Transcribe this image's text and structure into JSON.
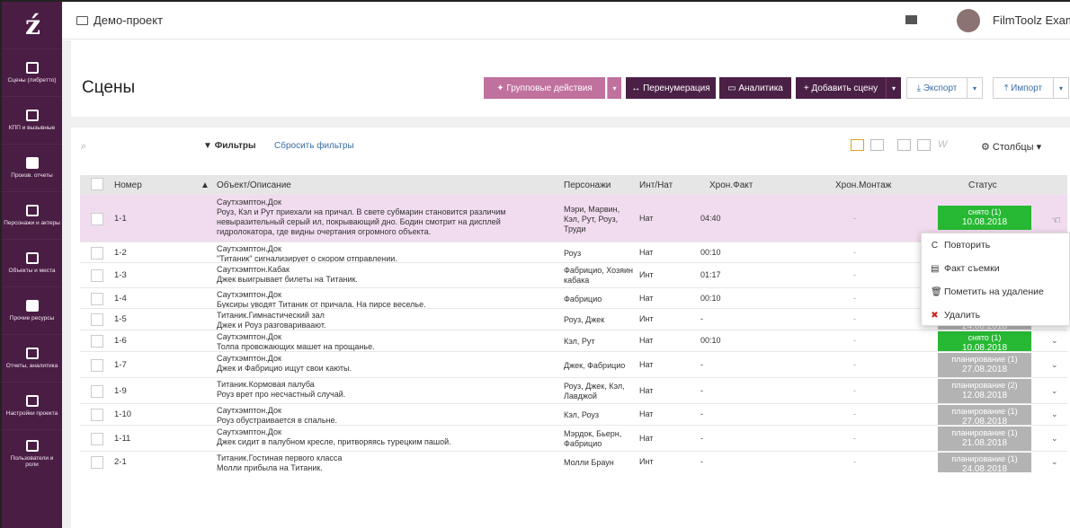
{
  "sidebar": {
    "logo": "ź",
    "items": [
      {
        "label": "Сцены (либретто)",
        "icon": "clapperboard-icon"
      },
      {
        "label": "КПП и вызывные",
        "icon": "calendar-icon"
      },
      {
        "label": "Произв. отчеты",
        "icon": "check-icon"
      },
      {
        "label": "Персонажи и актеры",
        "icon": "people-icon"
      },
      {
        "label": "Объекты и места",
        "icon": "image-icon"
      },
      {
        "label": "Прочие ресурсы",
        "icon": "box-icon"
      },
      {
        "label": "Отчеты, аналитика",
        "icon": "bar-chart-icon"
      },
      {
        "label": "Настройки проекта",
        "icon": "sliders-icon"
      },
      {
        "label": "Пользователи и роли",
        "icon": "users-icon"
      }
    ]
  },
  "topbar": {
    "project": "Демо-проект",
    "username": "FilmToolz Examp"
  },
  "header": {
    "title": "Сцены",
    "group_actions": "Групповые действия",
    "renumber": "Перенумерация",
    "analytics": "Аналитика",
    "add_scene": "+ Добавить сцену",
    "export": "Экспорт",
    "import": "Импорт"
  },
  "toolbar": {
    "search_placeholder": "",
    "filters": "Фильтры",
    "reset_filters": "Сбросить фильтры",
    "columns": "Столбцы"
  },
  "table": {
    "columns": {
      "num": "Номер",
      "obj": "Объект/Описание",
      "per": "Персонажи",
      "int": "Инт/Нат",
      "hf": "Хрон.Факт",
      "hm": "Хрон.Монтаж",
      "stat": "Статус"
    },
    "rows": [
      {
        "num": "1-1",
        "title": "Саутхэмптон.Док",
        "desc": "Роуз, Кэл и Рут приехали на причал. В свете субмарин становится различим невыразительный серый ил, покрывающий дно. Бодин смотрит на дисплей гидролокатора, где видны очертания огромного объекта.",
        "per": "Мэри, Марвин, Кэл, Рут, Роуз, Труди",
        "int": "Нат",
        "hf": "04:40",
        "hm": "-",
        "status": "снято (1)",
        "date": "10.08.2018",
        "color": "green"
      },
      {
        "num": "1-2",
        "title": "Саутхэмптон.Док",
        "desc": "\"Титаник\" сигнализирует о скором отправлении.",
        "per": "Роуз",
        "int": "Нат",
        "hf": "00:10",
        "hm": "-",
        "status": "",
        "date": "",
        "color": "none"
      },
      {
        "num": "1-3",
        "title": "Саутхэмптон.Кабак",
        "desc": "Джек выигрывает билеты на Титаник.",
        "per": "Фабрицио, Хозяин кабака",
        "int": "Инт",
        "hf": "01:17",
        "hm": "-",
        "status": "",
        "date": "",
        "color": "none"
      },
      {
        "num": "1-4",
        "title": "Саутхэмптон.Док",
        "desc": "Буксиры уводят Титаник от причала. На пирсе веселье.",
        "per": "Фабрицио",
        "int": "Нат",
        "hf": "00:10",
        "hm": "-",
        "status": "",
        "date": "",
        "color": "none"
      },
      {
        "num": "1-5",
        "title": "Титаник.Гимнастический зал",
        "desc": "Джек и Роуз разговариваают.",
        "per": "Роуз, Джек",
        "int": "Инт",
        "hf": "-",
        "hm": "-",
        "status": "планирование (1)",
        "date": "24.08.2018",
        "color": "gray"
      },
      {
        "num": "1-6",
        "title": "Саутхэмптон.Док",
        "desc": "Толпа провожающих машет на прощанье.",
        "per": "Кэл, Рут",
        "int": "Нат",
        "hf": "00:10",
        "hm": "-",
        "status": "снято (1)",
        "date": "10.08.2018",
        "color": "green"
      },
      {
        "num": "1-7",
        "title": "Саутхэмптон.Док",
        "desc": "Джек и Фабрицио ищут свои каюты.",
        "per": "Джек, Фабрицио",
        "int": "Нат",
        "hf": "-",
        "hm": "-",
        "status": "планирование (1)",
        "date": "27.08.2018",
        "color": "gray"
      },
      {
        "num": "1-9",
        "title": "Титаник.Кормовая палуба",
        "desc": "Роуз врет про несчастный случай.",
        "per": "Роуз, Джек, Кэл, Лавджой",
        "int": "Нат",
        "hf": "-",
        "hm": "-",
        "status": "планирование (2)",
        "date": "12.08.2018",
        "color": "gray"
      },
      {
        "num": "1-10",
        "title": "Саутхэмптон.Док",
        "desc": "Роуз обустраивается в спальне.",
        "per": "Кэл, Роуз",
        "int": "Нат",
        "hf": "-",
        "hm": "-",
        "status": "планирование (1)",
        "date": "27.08.2018",
        "color": "gray"
      },
      {
        "num": "1-11",
        "title": "Саутхэмптон.Док",
        "desc": "Джек сидит в палубном кресле, притворяясь турецким пашой.",
        "per": "Мэрдок, Бьерн, Фабрицио",
        "int": "Нат",
        "hf": "-",
        "hm": "-",
        "status": "планирование (1)",
        "date": "21.08.2018",
        "color": "gray"
      },
      {
        "num": "2-1",
        "title": "Титаник.Гостиная первого класса",
        "desc": "Молли прибыла на Титаник.",
        "per": "Молли Браун",
        "int": "Инт",
        "hf": "-",
        "hm": "-",
        "status": "планирование (1)",
        "date": "24.08.2018",
        "color": "gray"
      }
    ]
  },
  "context_menu": {
    "repeat": "Повторить",
    "fact": "Факт съемки",
    "mark_delete": "Пометить на удаление",
    "delete": "Удалить"
  }
}
